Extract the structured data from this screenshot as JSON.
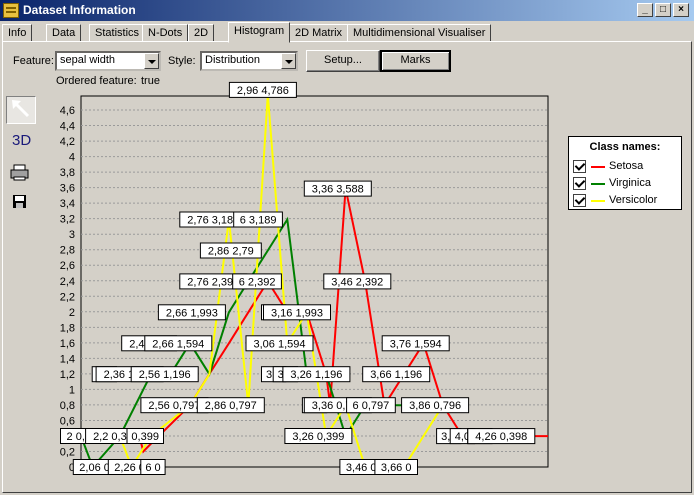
{
  "window": {
    "title": "Dataset Information",
    "buttons": {
      "minimize": "_",
      "maximize": "□",
      "close": "×"
    }
  },
  "tabs": [
    "Info",
    "Data",
    "Statistics",
    "N-Dots",
    "2D",
    "Histogram",
    "2D Matrix",
    "Multidimensional Visualiser"
  ],
  "active_tab": "Histogram",
  "controls": {
    "feature_label": "Feature:",
    "feature_value": "sepal width",
    "style_label": "Style:",
    "style_value": "Distribution",
    "setup_button": "Setup...",
    "marks_button": "Marks",
    "ordered_label": "Ordered feature:",
    "ordered_value": "true"
  },
  "toolbar": {
    "tools": [
      {
        "name": "pointer-icon",
        "pressed": true
      },
      {
        "name": "3d-icon",
        "label": "3D"
      },
      {
        "name": "print-icon"
      },
      {
        "name": "save-icon"
      }
    ]
  },
  "legend": {
    "title": "Class names:",
    "items": [
      {
        "name": "Setosa",
        "color": "#ff0000",
        "checked": true
      },
      {
        "name": "Virginica",
        "color": "#008000",
        "checked": true
      },
      {
        "name": "Versicolor",
        "color": "#ffff00",
        "checked": true
      }
    ]
  },
  "chart_data": {
    "type": "line",
    "ylim": [
      0,
      4.8
    ],
    "y_ticks": [
      "0",
      "0,2",
      "0,4",
      "0,6",
      "0,8",
      "1",
      "1,2",
      "1,4",
      "1,6",
      "1,8",
      "2",
      "2,2",
      "2,4",
      "2,6",
      "2,8",
      "3",
      "3,2",
      "3,4",
      "3,6",
      "3,8",
      "4",
      "4,2",
      "4,4",
      "4,6"
    ],
    "xlim": [
      2.0,
      4.4
    ],
    "grid": true,
    "series": [
      {
        "name": "Setosa",
        "color": "#ff0000",
        "points": [
          [
            2.3,
            0.4
          ],
          [
            2.32,
            0.2
          ],
          [
            2.36,
            0.3
          ],
          [
            2.56,
            0.797
          ],
          [
            2.66,
            1.2
          ],
          [
            2.76,
            1.594
          ],
          [
            2.86,
            1.993
          ],
          [
            2.96,
            2.392
          ],
          [
            3.06,
            1.993
          ],
          [
            3.16,
            1.993
          ],
          [
            3.26,
            1.196
          ],
          [
            3.28,
            0.8
          ],
          [
            3.36,
            3.588
          ],
          [
            3.46,
            2.392
          ],
          [
            3.56,
            0.797
          ],
          [
            3.66,
            1.196
          ],
          [
            3.76,
            1.594
          ],
          [
            3.86,
            0.797
          ],
          [
            3.96,
            0.398
          ],
          [
            4.06,
            0.398
          ],
          [
            4.16,
            0.398
          ],
          [
            4.26,
            0.398
          ],
          [
            4.4,
            0.398
          ]
        ]
      },
      {
        "name": "Virginica",
        "color": "#008000",
        "points": [
          [
            2.0,
            0.399
          ],
          [
            2.06,
            0.0
          ],
          [
            2.2,
            0.399
          ],
          [
            2.36,
            1.196
          ],
          [
            2.46,
            1.196
          ],
          [
            2.56,
            1.594
          ],
          [
            2.66,
            1.196
          ],
          [
            2.76,
            1.993
          ],
          [
            2.86,
            2.392
          ],
          [
            2.96,
            2.79
          ],
          [
            3.06,
            3.189
          ],
          [
            3.16,
            1.196
          ],
          [
            3.26,
            1.196
          ],
          [
            3.36,
            0.399
          ],
          [
            3.46,
            0.797
          ],
          [
            3.56,
            0.797
          ],
          [
            3.66,
            0.797
          ],
          [
            3.76,
            0.797
          ]
        ]
      },
      {
        "name": "Versicolor",
        "color": "#ffff00",
        "points": [
          [
            2.2,
            0.399
          ],
          [
            2.26,
            0.0
          ],
          [
            2.36,
            0.399
          ],
          [
            2.56,
            0.797
          ],
          [
            2.66,
            1.196
          ],
          [
            2.76,
            3.189
          ],
          [
            2.86,
            0.797
          ],
          [
            2.96,
            4.8
          ],
          [
            3.06,
            1.594
          ],
          [
            3.16,
            1.993
          ],
          [
            3.26,
            0.399
          ],
          [
            3.36,
            0.797
          ],
          [
            3.46,
            0.0
          ],
          [
            3.66,
            0.0
          ],
          [
            3.86,
            0.796
          ],
          [
            3.96,
            0.796
          ]
        ]
      }
    ],
    "annotations": [
      {
        "text": "2 0,399",
        "x": 2.02,
        "y": 0.399
      },
      {
        "text": "2,06 0",
        "x": 2.07,
        "y": 0.0
      },
      {
        "text": "2,2 0,399",
        "x": 2.18,
        "y": 0.399
      },
      {
        "text": "2,26 0",
        "x": 2.25,
        "y": 0.0
      },
      {
        "text": "0,399",
        "x": 2.33,
        "y": 0.399
      },
      {
        "text": "6 0",
        "x": 2.37,
        "y": 0.0
      },
      {
        "text": "2,2",
        "x": 2.12,
        "y": 1.196
      },
      {
        "text": "2,36 1,196",
        "x": 2.25,
        "y": 1.196
      },
      {
        "text": "2,56 1,196",
        "x": 2.43,
        "y": 1.196
      },
      {
        "text": "2,46 1,5",
        "x": 2.35,
        "y": 1.594
      },
      {
        "text": "2,66 1,594",
        "x": 2.5,
        "y": 1.594
      },
      {
        "text": "2,56 0,797",
        "x": 2.48,
        "y": 0.797
      },
      {
        "text": "2,66 1,993",
        "x": 2.57,
        "y": 1.993
      },
      {
        "text": "2,76 3,189",
        "x": 2.68,
        "y": 3.189
      },
      {
        "text": "2,86 2,79",
        "x": 2.77,
        "y": 2.79
      },
      {
        "text": "2,76 2,392",
        "x": 2.68,
        "y": 2.392
      },
      {
        "text": "6 2,392",
        "x": 2.905,
        "y": 2.392
      },
      {
        "text": "6 3,189",
        "x": 2.91,
        "y": 3.189
      },
      {
        "text": "2,86 0,797",
        "x": 2.77,
        "y": 0.797
      },
      {
        "text": "3,0",
        "x": 2.99,
        "y": 1.993
      },
      {
        "text": "3,16 1,993",
        "x": 3.11,
        "y": 1.993
      },
      {
        "text": "3,06 1,594",
        "x": 3.02,
        "y": 1.594
      },
      {
        "text": "3,0",
        "x": 2.99,
        "y": 1.196
      },
      {
        "text": "3,1",
        "x": 3.05,
        "y": 1.196
      },
      {
        "text": "3,26 1,196",
        "x": 3.21,
        "y": 1.196
      },
      {
        "text": "3,2",
        "x": 3.2,
        "y": 0.797
      },
      {
        "text": "3,36 0,797",
        "x": 3.32,
        "y": 0.797
      },
      {
        "text": "6 0,797",
        "x": 3.49,
        "y": 0.797
      },
      {
        "text": "3,26 0,399",
        "x": 3.22,
        "y": 0.399
      },
      {
        "text": "3,36 3,588",
        "x": 3.32,
        "y": 3.588
      },
      {
        "text": "3,46 2,392",
        "x": 3.42,
        "y": 2.392
      },
      {
        "text": "3,46 0",
        "x": 3.44,
        "y": 0.0
      },
      {
        "text": "3,66 0",
        "x": 3.62,
        "y": 0.0
      },
      {
        "text": "3,66 1,196",
        "x": 3.62,
        "y": 1.196
      },
      {
        "text": "3,76 1,594",
        "x": 3.72,
        "y": 1.594
      },
      {
        "text": "3,86 0,796",
        "x": 3.82,
        "y": 0.796
      },
      {
        "text": "3,9",
        "x": 3.89,
        "y": 0.398
      },
      {
        "text": "4,0",
        "x": 3.96,
        "y": 0.398
      },
      {
        "text": "4,1",
        "x": 4.05,
        "y": 0.398
      },
      {
        "text": "4,26 0,398",
        "x": 4.16,
        "y": 0.398
      },
      {
        "text": "2,96 4,786",
        "x": 2.935,
        "y": 4.86
      }
    ]
  }
}
